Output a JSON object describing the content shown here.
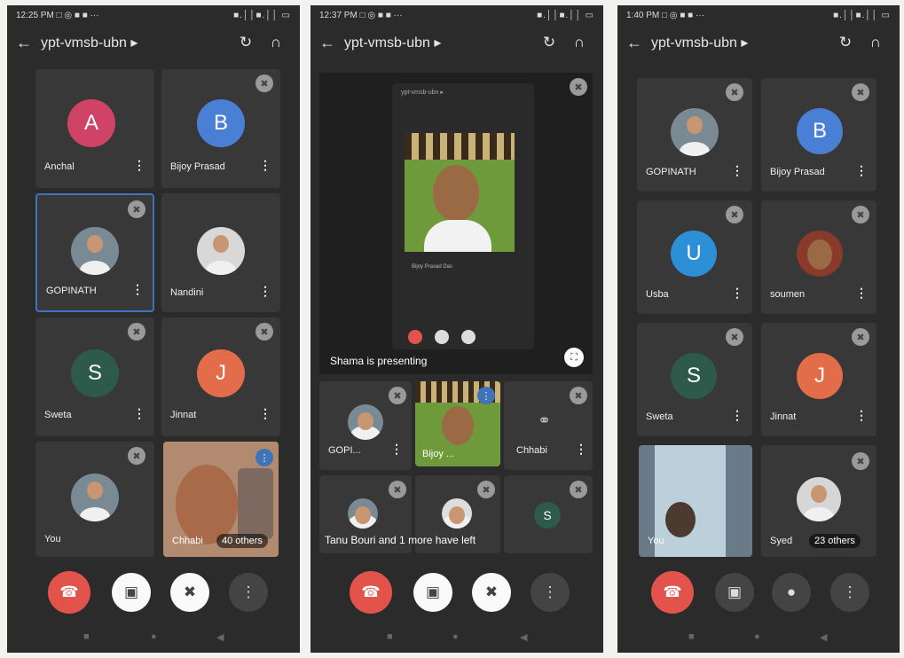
{
  "screens": [
    {
      "time": "12:25 PM",
      "status_icons": "□ ◎ ■ ■ ···",
      "signal": "■.││■.││ ▭",
      "meeting_code": "ypt-vmsb-ubn ▸",
      "participants": [
        {
          "name": "Anchal",
          "initial": "A",
          "color": "#cf4466"
        },
        {
          "name": "Bijoy Prasad",
          "initial": "B",
          "color": "#4a7fd6"
        },
        {
          "name": "GOPINATH",
          "initial": ""
        },
        {
          "name": "Nandini",
          "initial": ""
        },
        {
          "name": "Sweta",
          "initial": "S",
          "color": "#2d5a4a"
        },
        {
          "name": "Jinnat",
          "initial": "J",
          "color": "#e36c4a"
        },
        {
          "name": "You",
          "initial": ""
        },
        {
          "name": "Chhabi",
          "initial": ""
        }
      ],
      "others_label": "40 others"
    },
    {
      "time": "12:37 PM",
      "status_icons": "□ ◎ ■ ■ ···",
      "signal": "■.││■.││ ▭",
      "meeting_code": "ypt-vmsb-ubn ▸",
      "presenting_label": "Shama is presenting",
      "inner_meeting_code": "ypt-vmsb-ubn ▸",
      "inner_name": "Bijoy Prasad Das",
      "participants": [
        {
          "name": "GOPI...",
          "initial": ""
        },
        {
          "name": "Bijoy ...",
          "initial": ""
        },
        {
          "name": "Chhabi",
          "initial": ""
        }
      ],
      "bottom_initial": "S",
      "left_label": "Tanu Bouri and 1 more have left"
    },
    {
      "time": "1:40 PM",
      "status_icons": "□ ◎ ■ ■ ···",
      "signal": "■.││■.││ ▭",
      "meeting_code": "ypt-vmsb-ubn ▸",
      "participants": [
        {
          "name": "GOPINATH",
          "initial": ""
        },
        {
          "name": "Bijoy Prasad",
          "initial": "B",
          "color": "#4a7fd6"
        },
        {
          "name": "Usba",
          "initial": "U",
          "color": "#2d8fd6"
        },
        {
          "name": "soumen",
          "initial": ""
        },
        {
          "name": "Sweta",
          "initial": "S",
          "color": "#2d5a4a"
        },
        {
          "name": "Jinnat",
          "initial": "J",
          "color": "#e36c4a"
        },
        {
          "name": "You",
          "initial": ""
        },
        {
          "name": "Syed",
          "initial": ""
        }
      ],
      "others_label": "23 others"
    }
  ],
  "icons": {
    "back": "←",
    "switch_camera": "↻",
    "audio": "∩",
    "menu": "⋮",
    "mic_off": "✖",
    "end_call": "☎",
    "nav_home": "●",
    "nav_back": "◀",
    "nav_recents": "■"
  }
}
